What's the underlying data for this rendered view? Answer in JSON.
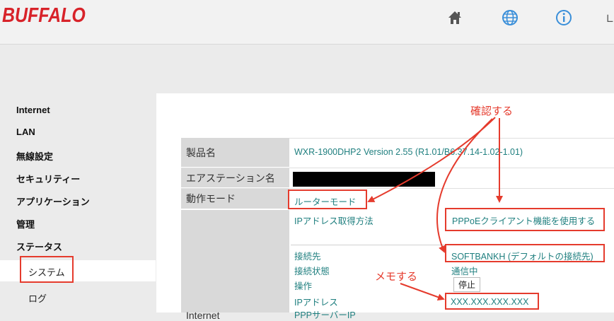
{
  "header": {
    "logo": "BUFFALO",
    "icons": [
      "home-icon",
      "globe-icon",
      "info-icon",
      "logout-icon"
    ],
    "brand_color": "#d8232a",
    "icon_color": "#3a8fd9"
  },
  "sidebar": {
    "items": [
      "Internet",
      "LAN",
      "無線設定",
      "セキュリティー",
      "アプリケーション",
      "管理",
      "ステータス"
    ],
    "sub_items": [
      "システム",
      "ログ"
    ]
  },
  "system": {
    "rows": [
      {
        "label": "製品名",
        "value": "WXR-1900DHP2  Version 2.55 (R1.01/B6.37.14-1.02-1.01)"
      },
      {
        "label": "エアステーション名",
        "value": ""
      },
      {
        "label": "動作モード",
        "value": "ルーターモード"
      }
    ],
    "internet_label": "Internet",
    "ip_method_label": "IPアドレス取得方法",
    "ip_method_value": "PPPoEクライアント機能を使用する",
    "connection": [
      {
        "label": "接続先",
        "value": "SOFTBANKH (デフォルトの接続先)"
      },
      {
        "label": "接続状態",
        "value": "通信中"
      },
      {
        "label": "操作",
        "value": "停止"
      },
      {
        "label": "IPアドレス",
        "value": "XXX.XXX.XXX.XXX"
      },
      {
        "label": "PPPサーバーIP",
        "value": ""
      }
    ]
  },
  "annotations": {
    "confirm": "確認する",
    "memo": "メモする",
    "color": "#e53b2d"
  }
}
